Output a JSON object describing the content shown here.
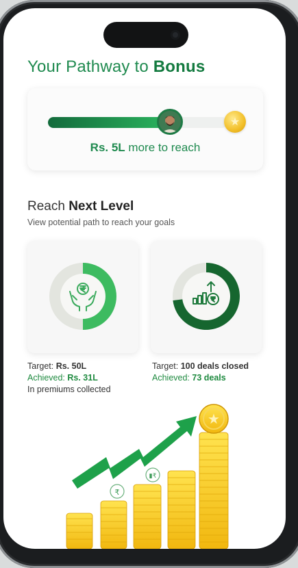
{
  "header": {
    "title_prefix": "Your Pathway to ",
    "title_highlight": "Bonus"
  },
  "progress": {
    "fraction": 0.68,
    "amount": "Rs. 5L",
    "text_suffix": " more to reach"
  },
  "next_level": {
    "title_prefix": "Reach ",
    "title_highlight": "Next Level",
    "subtitle": "View potential path to reach your goals"
  },
  "kpis": [
    {
      "target_label": "Target: ",
      "target_value": "Rs. 50L",
      "achieved_label": "Achieved: ",
      "achieved_value": "Rs. 31L",
      "note": "In premiums collected",
      "progress_fraction": 0.62,
      "icon": "hand-rupee-icon"
    },
    {
      "target_label": "Target: ",
      "target_value": "100 deals closed",
      "achieved_label": "Achieved: ",
      "achieved_value": "73 deals",
      "note": "",
      "progress_fraction": 0.73,
      "icon": "chart-rupee-icon"
    }
  ],
  "colors": {
    "brand_green": "#1f8a4f",
    "dark_green": "#136b3c",
    "gold": "#f2bf28"
  }
}
